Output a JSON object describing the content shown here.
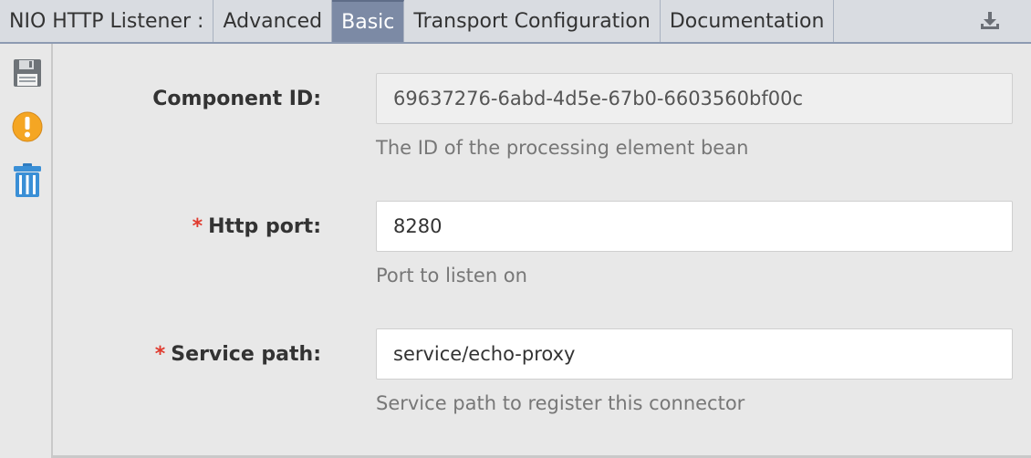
{
  "header": {
    "title": "NIO HTTP Listener :",
    "tabs": [
      {
        "label": "Advanced",
        "active": false
      },
      {
        "label": "Basic",
        "active": true
      },
      {
        "label": "Transport Configuration",
        "active": false
      },
      {
        "label": "Documentation",
        "active": false
      }
    ],
    "download_icon": "download-icon"
  },
  "toolbar": {
    "icons": [
      "save-icon",
      "warning-icon",
      "trash-icon"
    ]
  },
  "form": {
    "component_id": {
      "label": "Component ID:",
      "value": "69637276-6abd-4d5e-67b0-6603560bf00c",
      "help": "The ID of the processing element bean",
      "required": false
    },
    "http_port": {
      "required_mark": "*",
      "label": "Http port:",
      "value": "8280",
      "help": "Port to listen on",
      "required": true
    },
    "service_path": {
      "required_mark": "*",
      "label": "Service path:",
      "value": "service/echo-proxy",
      "help": "Service path to register this connector",
      "required": true
    }
  },
  "colors": {
    "active_tab": "#7c8aa5",
    "tabbar": "#d9dce1",
    "background": "#e8e8e8",
    "required": "#e03a2e",
    "warning": "#f5a623",
    "trash": "#3a8fd6"
  }
}
